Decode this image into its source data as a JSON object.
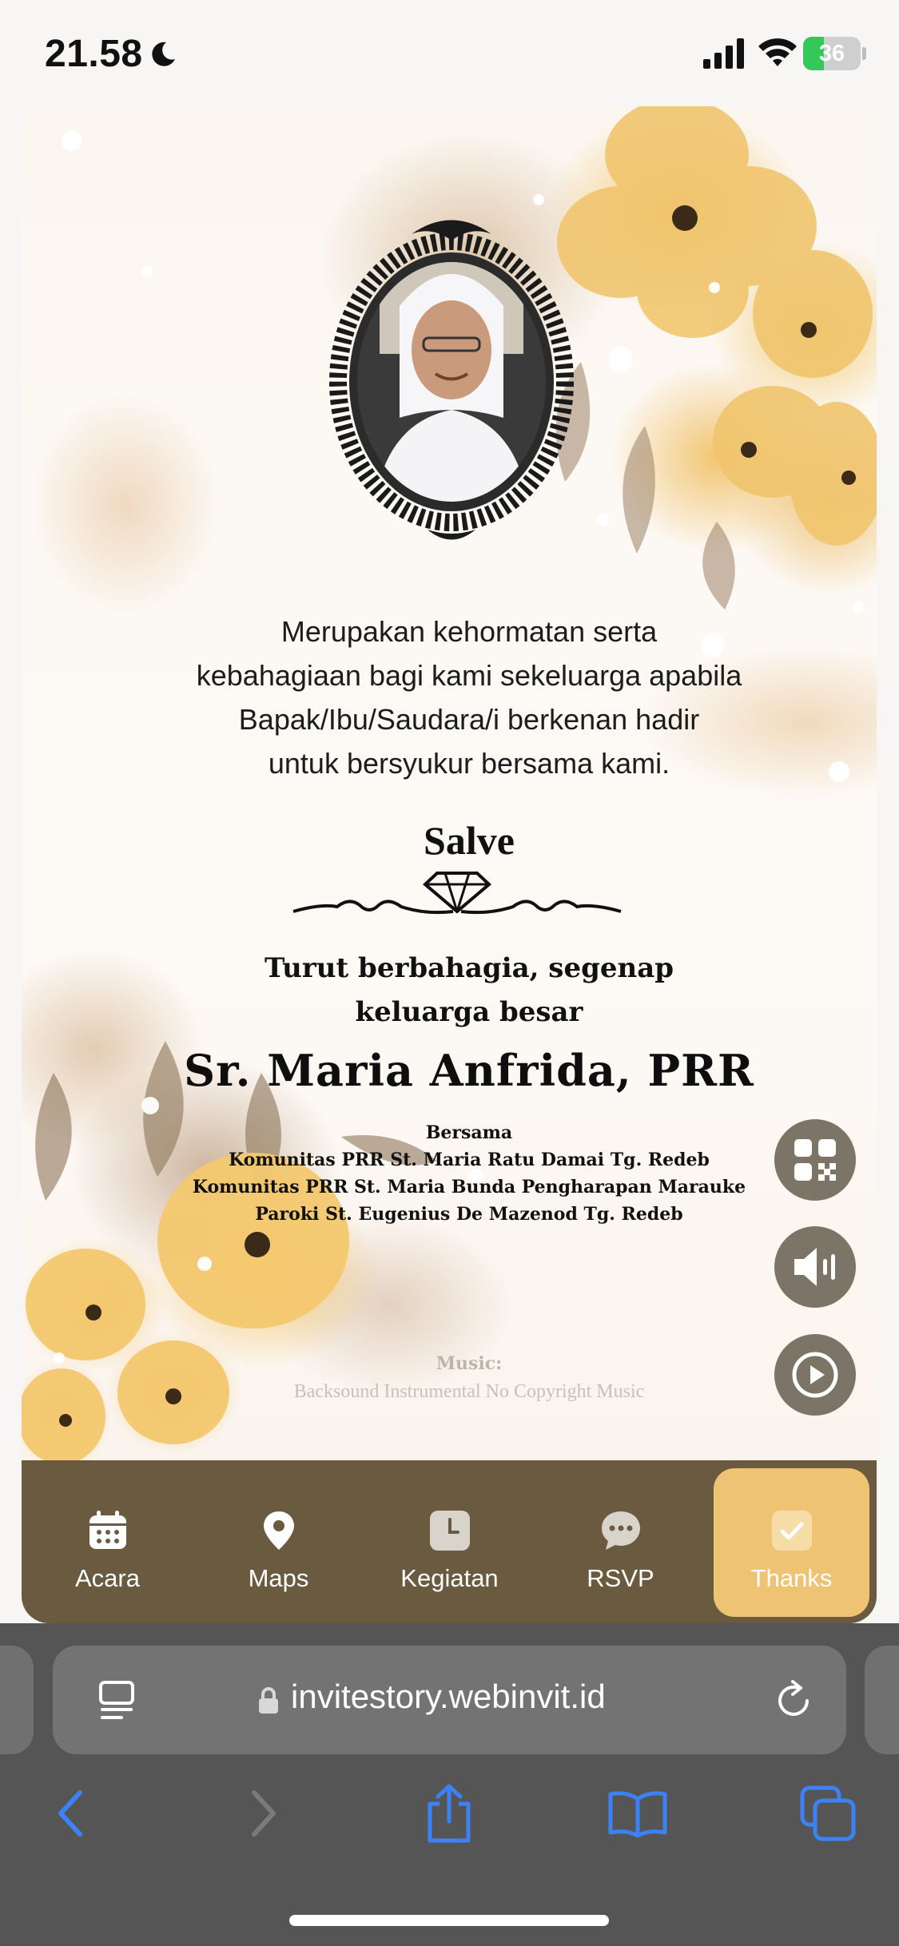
{
  "status_bar": {
    "time": "21.58",
    "battery_level": "36",
    "battery_fraction": 0.36,
    "icons": [
      "moon-icon",
      "signal-icon",
      "wifi-icon",
      "battery-icon"
    ]
  },
  "invitation": {
    "intro_lines": [
      "Merupakan kehormatan serta",
      "kebahagiaan bagi kami sekeluarga apabila",
      "Bapak/Ibu/Saudara/i berkenan hadir",
      "untuk bersyukur bersama kami."
    ],
    "salve": "Salve",
    "sub_heading_lines": [
      "Turut berbahagia, segenap",
      "keluarga besar"
    ],
    "honoree": "Sr. Maria Anfrida, PRR",
    "together_lines": [
      "Bersama",
      "Komunitas PRR St. Maria Ratu Damai Tg. Redeb",
      "Komunitas PRR St. Maria Bunda Pengharapan Marauke",
      "Paroki St. Eugenius De Mazenod Tg. Redeb"
    ],
    "music_label": "Music:",
    "music_title": "Backsound Instrumental No Copyright Music"
  },
  "floating_buttons": [
    "qr-code-icon",
    "speaker-icon",
    "play-icon"
  ],
  "bottom_nav": {
    "items": [
      {
        "label": "Acara",
        "icon": "calendar-icon"
      },
      {
        "label": "Maps",
        "icon": "map-pin-icon"
      },
      {
        "label": "Kegiatan",
        "icon": "clock-icon"
      },
      {
        "label": "RSVP",
        "icon": "chat-bubble-icon"
      },
      {
        "label": "Thanks",
        "icon": "checkmark-icon"
      }
    ],
    "active_label": "Thanks"
  },
  "browser": {
    "url": "invitestory.webinvit.id",
    "toolbar_icons": [
      "back-icon",
      "forward-icon",
      "share-icon",
      "bookmarks-icon",
      "tabs-icon"
    ]
  },
  "colors": {
    "nav_background": "#695a40",
    "nav_active": "#eec374",
    "fab_background": "#7d7468",
    "browser_accent": "#3b82f6",
    "battery_green": "#34c759"
  }
}
